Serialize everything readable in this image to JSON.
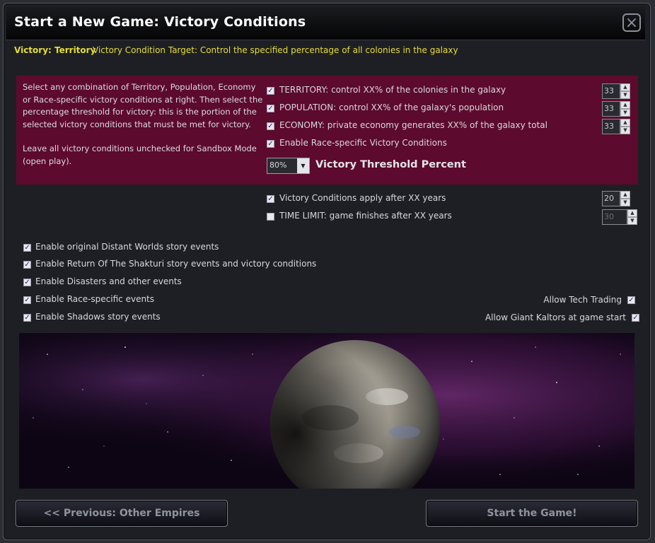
{
  "window": {
    "title": "Start a New Game: Victory Conditions",
    "close_icon": "close-icon"
  },
  "subtitle": {
    "label": "Victory: Territory",
    "description": "Victory Condition Target: Control the specified percentage of all colonies in the galaxy"
  },
  "instructions": {
    "paragraph1": "Select any combination of Territory, Population, Economy or Race-specific victory conditions at right. Then select the percentage threshold for victory: this is the portion of the selected victory conditions that must be met for victory.",
    "paragraph2": "Leave all victory conditions unchecked for Sandbox Mode (open play)."
  },
  "conditions": {
    "territory": {
      "label": "TERRITORY: control XX% of the colonies in the galaxy",
      "checked": true,
      "value": "33"
    },
    "population": {
      "label": "POPULATION: control XX% of the galaxy's population",
      "checked": true,
      "value": "33"
    },
    "economy": {
      "label": "ECONOMY: private economy generates XX% of the galaxy total",
      "checked": true,
      "value": "33"
    },
    "race_specific": {
      "label": "Enable Race-specific Victory Conditions",
      "checked": true
    }
  },
  "threshold": {
    "value": "80%",
    "label": "Victory Threshold Percent"
  },
  "timing": {
    "apply_after": {
      "label": "Victory Conditions apply after XX years",
      "checked": true,
      "value": "20"
    },
    "time_limit": {
      "label": "TIME LIMIT: game finishes after XX years",
      "checked": false,
      "value": "30"
    }
  },
  "events": {
    "original": "Enable original Distant Worlds story events",
    "shakturi": "Enable Return Of The Shakturi story events and victory conditions",
    "disasters": "Enable Disasters and other events",
    "race": "Enable Race-specific events",
    "shadows": "Enable Shadows story events"
  },
  "options": {
    "tech_trading": "Allow Tech Trading",
    "giant_kaltors": "Allow Giant Kaltors at game start"
  },
  "buttons": {
    "previous": "<< Previous: Other Empires",
    "start": "Start the Game!"
  },
  "colors": {
    "accent_yellow": "#e6dd37",
    "panel_maroon": "#5c0a2d",
    "checkmark": "#1d1d70"
  }
}
